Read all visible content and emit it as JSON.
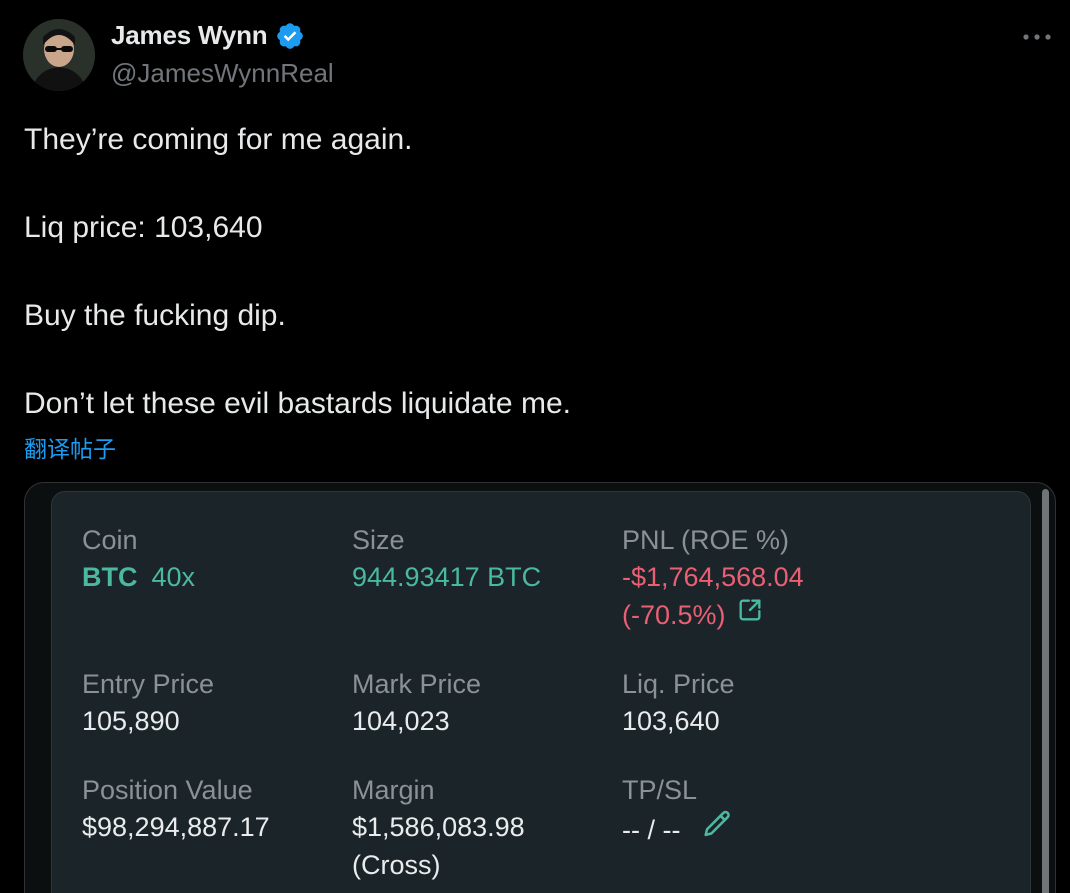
{
  "author": {
    "display_name": "James Wynn",
    "handle": "@JamesWynnReal",
    "avatar_icon": "avatar-photo-icon",
    "verified_icon": "verified-badge-icon"
  },
  "more_icon": "more-options-icon",
  "tweet": {
    "lines": [
      "They’re coming for me again.",
      "Liq price: 103,640",
      "Buy the fucking dip.",
      "Don’t let these evil bastards liquidate me."
    ],
    "translate_label": "翻译帖子"
  },
  "position": {
    "coin": {
      "label": "Coin",
      "symbol": "BTC",
      "leverage": "40x"
    },
    "size": {
      "label": "Size",
      "value": "944.93417 BTC"
    },
    "pnl": {
      "label": "PNL (ROE %)",
      "value": "-$1,764,568.04",
      "roe": "(-70.5%)",
      "share_icon": "external-link-icon"
    },
    "entry_price": {
      "label": "Entry Price",
      "value": "105,890"
    },
    "mark_price": {
      "label": "Mark Price",
      "value": "104,023"
    },
    "liq_price": {
      "label": "Liq. Price",
      "value": "103,640"
    },
    "position_value": {
      "label": "Position Value",
      "value": "$98,294,887.17"
    },
    "margin": {
      "label": "Margin",
      "value": "$1,586,083.98",
      "mode": "(Cross)"
    },
    "tpsl": {
      "label": "TP/SL",
      "value": "-- / --",
      "edit_icon": "pencil-icon"
    }
  },
  "colors": {
    "positive": "#4ab99f",
    "negative": "#ea5f73",
    "link": "#1d9bf0",
    "verified": "#1d9bf0",
    "card_bg": "#1b2429"
  }
}
